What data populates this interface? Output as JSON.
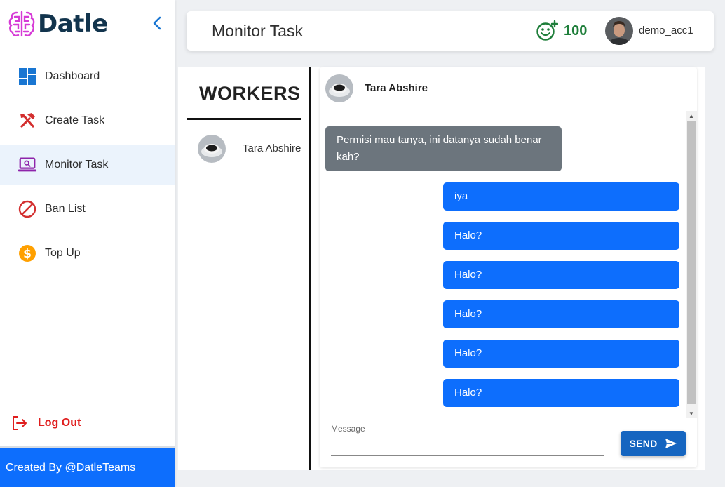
{
  "brand": {
    "name": "Datle"
  },
  "sidebar": {
    "items": [
      {
        "label": "Dashboard",
        "icon": "dashboard-icon",
        "active": false
      },
      {
        "label": "Create Task",
        "icon": "tools-icon",
        "active": false
      },
      {
        "label": "Monitor Task",
        "icon": "laptop-icon",
        "active": true
      },
      {
        "label": "Ban List",
        "icon": "ban-icon",
        "active": false
      },
      {
        "label": "Top Up",
        "icon": "dollar-icon",
        "active": false
      }
    ],
    "logout_label": "Log Out",
    "footer": "Created By @DatleTeams"
  },
  "header": {
    "title": "Monitor Task",
    "score": "100",
    "username": "demo_acc1"
  },
  "workers": {
    "title": "WORKERS",
    "list": [
      {
        "name": "Tara Abshire"
      }
    ]
  },
  "chat": {
    "contact": "Tara Abshire",
    "messages": [
      {
        "direction": "in",
        "text": "Permisi mau tanya, ini datanya sudah benar kah?"
      },
      {
        "direction": "out",
        "text": "iya"
      },
      {
        "direction": "out",
        "text": "Halo?"
      },
      {
        "direction": "out",
        "text": "Halo?"
      },
      {
        "direction": "out",
        "text": "Halo?"
      },
      {
        "direction": "out",
        "text": "Halo?"
      },
      {
        "direction": "out",
        "text": "Halo?"
      }
    ],
    "input_label": "Message",
    "input_value": "",
    "send_label": "SEND"
  },
  "colors": {
    "primary": "#0d6efd",
    "incoming_bubble": "#6c757d",
    "brand_text": "#12344d",
    "logout": "#e01e1e",
    "score": "#1e7e3a",
    "active_nav_bg": "#ebf3fc"
  }
}
